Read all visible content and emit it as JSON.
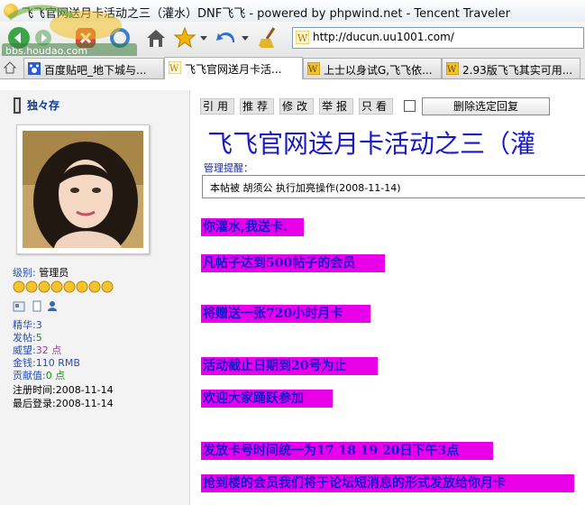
{
  "window": {
    "title": "飞飞官网送月卡活动之三（灌水）DNF飞飞 - powered by phpwind.net - Tencent Traveler"
  },
  "watermark": "bbs.houdao.com",
  "address_bar": {
    "url": "http://ducun.uu1001.com/"
  },
  "tabs": [
    {
      "label": "百度贴吧_地下城与..."
    },
    {
      "label": "飞飞官网送月卡活..."
    },
    {
      "label": "上士以身试G,飞飞依..."
    },
    {
      "label": "2.93版飞飞其实可用..."
    }
  ],
  "user": {
    "name": "独々存",
    "level_label": "级别:",
    "level_value": "管理员",
    "stats": [
      {
        "label": "精华:",
        "value": "3",
        "color": "#2a4fb0"
      },
      {
        "label": "发帖:",
        "value": "5",
        "color": "#228822"
      },
      {
        "label": "威望:",
        "value": "32 点",
        "color": "#9a40a0"
      },
      {
        "label": "金钱:",
        "value": "110 RMB",
        "color": "#2a4fb0"
      },
      {
        "label": "贡献值:",
        "value": "0 点",
        "color": "#228822"
      }
    ],
    "register": "注册时间:2008-11-14",
    "last_login": "最后登录:2008-11-14"
  },
  "post_actions": [
    "引用",
    "推荐",
    "修改",
    "举报",
    "只看"
  ],
  "delete_button": "删除选定回复",
  "post": {
    "title": "飞飞官网送月卡活动之三（灌",
    "moderator_label": "管理提醒：",
    "moderator_note": "本帖被 胡须公 执行加亮操作(2008-11-14)",
    "lines": [
      "你灌水,我送卡.",
      "凡帖子达到500帖子的会员",
      "将赠送一张720小时月卡",
      "活动截止日期到20号为止",
      "欢迎大家踊跃参加",
      "发放卡号时间统一为17 18 19 20日下午3点",
      "抢到楼的会员我们将于论坛短消息的形式发放给你月卡"
    ]
  },
  "colors": {
    "highlight": "#e800e8",
    "post_text": "#1818c8"
  }
}
